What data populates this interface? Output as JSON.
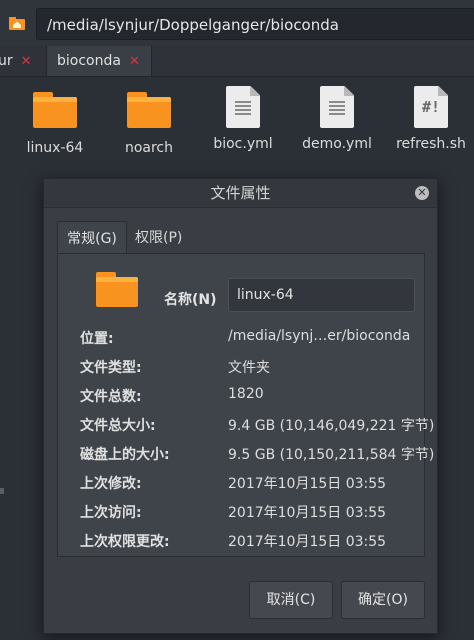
{
  "path": "/media/lsynjur/Doppelganger/bioconda",
  "tabs": {
    "prev_label": "ur",
    "active_label": "bioconda",
    "close_glyph": "✕"
  },
  "files": [
    {
      "name": "linux-64",
      "icon": "folder-icon"
    },
    {
      "name": "noarch",
      "icon": "folder-icon"
    },
    {
      "name": "bioc.yml",
      "icon": "text-file-icon"
    },
    {
      "name": "demo.yml",
      "icon": "text-file-icon"
    },
    {
      "name": "refresh.sh",
      "icon": "script-file-icon",
      "glyph": "#!"
    }
  ],
  "dialog": {
    "title": "文件属性",
    "tab_general": "常规(G)",
    "tab_permissions": "权限(P)",
    "name_label": "名称(N)",
    "name_value": "linux-64",
    "fields": [
      {
        "key": "位置:",
        "value": "/media/lsynj…er/bioconda"
      },
      {
        "key": "文件类型:",
        "value": "文件夹"
      },
      {
        "key": "文件总数:",
        "value": "1820"
      },
      {
        "key": "文件总大小:",
        "value": "9.4 GB (10,146,049,221 字节)"
      },
      {
        "key": "磁盘上的大小:",
        "value": "9.5 GB (10,150,211,584 字节)"
      },
      {
        "key": "上次修改:",
        "value": "2017年10月15日 03:55"
      },
      {
        "key": "上次访问:",
        "value": "2017年10月15日 03:55"
      },
      {
        "key": "上次权限更改:",
        "value": "2017年10月15日 03:55"
      }
    ],
    "cancel_label": "取消(C)",
    "ok_label": "确定(O)"
  },
  "colors": {
    "accent_folder": "#f7931e",
    "close_red": "#e0333b",
    "background": "#2b2f36"
  }
}
